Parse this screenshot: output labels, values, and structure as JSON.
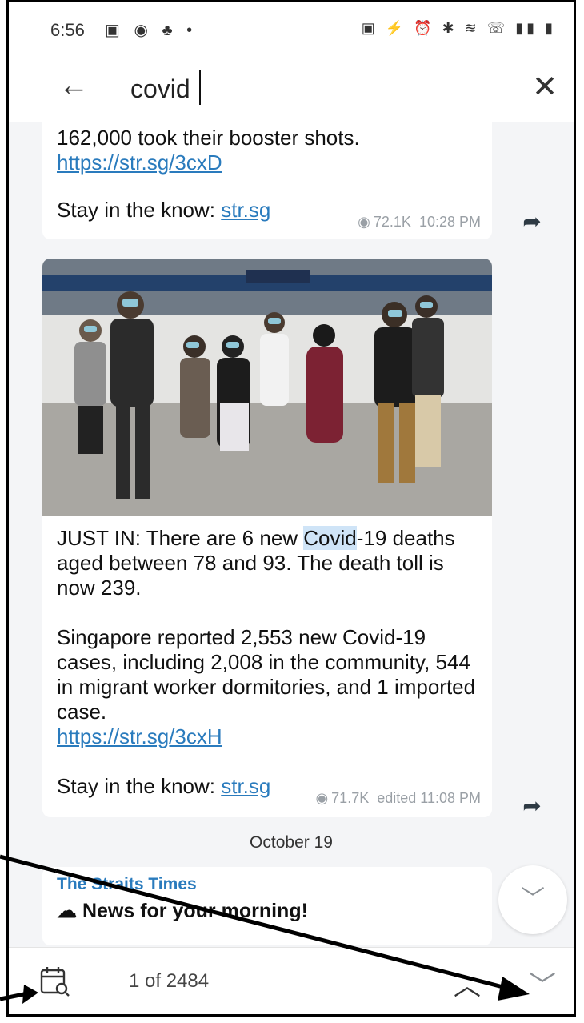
{
  "status_bar": {
    "time": "6:56",
    "left_icons": [
      "gallery-icon",
      "messenger-icon",
      "chat-icon",
      "dot"
    ],
    "right_icons": [
      "lock-icon",
      "phone-icon",
      "alarm-icon",
      "nfc-icon",
      "wifi-icon",
      "signal-icon",
      "battery-icon"
    ]
  },
  "search": {
    "query": "covid",
    "back_icon": "arrow-left-icon",
    "close_icon": "close-icon"
  },
  "messages": [
    {
      "text_line1": "162,000 took their booster shots.",
      "link1": "https://str.sg/3cxD",
      "stay_prefix": "Stay in the know: ",
      "stay_link": "str.sg",
      "views": "72.1K",
      "time": "10:28 PM"
    },
    {
      "para1_pre": "JUST IN: There are 6 new ",
      "para1_highlight": "Covid",
      "para1_post": "-19 deaths aged between 78 and 93. The death toll is now 239.",
      "para2": "Singapore reported 2,553 new Covid-19 cases, including 2,008 in the community, 544 in migrant worker dormitories, and 1 imported case.",
      "link": "https://str.sg/3cxH",
      "stay_prefix": "Stay in the know: ",
      "stay_link": "str.sg",
      "views": "71.7K",
      "time": "edited 11:08 PM"
    }
  ],
  "date_separator": "October 19",
  "preview": {
    "channel": "The Straits Times",
    "text": "News for your morning!"
  },
  "bottom": {
    "counter": "1 of 2484"
  },
  "colors": {
    "link": "#2a7bbd",
    "highlight": "#cfe4f7",
    "chat_background": "#f4f5f7"
  }
}
